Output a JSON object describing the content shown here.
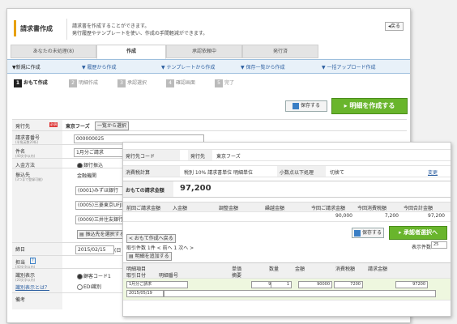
{
  "back": {
    "title": "請求書作成",
    "description": [
      "請求書を作成することができます。",
      "発行履歴やテンプレートを使い、作成の手間軽減ができます。"
    ],
    "back_button": "戻る",
    "tabs": [
      "あなたの未処理(8)",
      "作成",
      "承認依頼中",
      "発行済"
    ],
    "subnav": [
      "▼新規に作成",
      "▼ 履歴から作成",
      "▼ テンプレートから作成",
      "▼ 保存一覧から作成",
      "▼ 一括アップロード作成"
    ],
    "steps": [
      {
        "num": "1",
        "label": "おもて作成"
      },
      {
        "num": "2",
        "label": "明細作成"
      },
      {
        "num": "3",
        "label": "承認選択"
      },
      {
        "num": "4",
        "label": "確認画面"
      },
      {
        "num": "5",
        "label": "完了"
      }
    ],
    "save_button": "保存する",
    "create_detail_button": "明細を作成する",
    "form": {
      "issuer_label": "発行先",
      "required_badge": "必須",
      "issuer_value": "東京フーズ",
      "issuer_select": "一覧から選択",
      "invoice_no_label": "請求書番号",
      "invoice_no_sub": "(半角英数20桁)",
      "invoice_no_value": "000000025",
      "subject_label": "件名",
      "subject_sub": "(40文字以内)",
      "subject_value": "1月分ご請求",
      "payment_label": "入金方法",
      "payment_value": "銀行振込",
      "transfer_label": "振込先",
      "transfer_sub": "(3つまで登録可能)",
      "bank_header": "金融機関",
      "banks": [
        "(0001)みずほ銀行",
        "(0005)三菱東京UFJ銀行",
        "(0009)三井住友銀行"
      ],
      "bank_select": "振込先を選択する",
      "due_label": "締日",
      "due_value": "2015/02/15",
      "due_suffix": "(日",
      "person_label": "担当",
      "person_sub": "(40文字以内)",
      "code_label": "識別表示",
      "code_sub": "(20文字以内)",
      "code_link": "識別表示とは？",
      "code_option1": "顧客コード1",
      "code_option2": "EDI識別",
      "note_label": "備考"
    }
  },
  "front": {
    "issuer_code_label": "発行先コード",
    "issuer_label": "発行先",
    "issuer_value": "東京フーズ",
    "tax_calc_label": "消費税計算",
    "tax_calc_value": "税別 10% 請求書単位 明細単位",
    "tax_round_label": "小数点以下処理",
    "tax_round_value": "切捨て",
    "tax_link": "変更",
    "total_label": "おもての請求金額",
    "total_value": "97,200",
    "sum_headers": [
      "前回ご請求金額",
      "入金額",
      "調整金額",
      "繰越金額",
      "今回ご請求金額",
      "今回消費税額",
      "今回合計金額"
    ],
    "sum_values": [
      "",
      "",
      "",
      "",
      "90,000",
      "7,200",
      "97,200"
    ],
    "back_link": "< おもて作成へ戻る",
    "save_button": "保存する",
    "approver_button": "承認者選択へ",
    "display_count_label": "表示件数",
    "display_count_value": "25",
    "count_text": "取引件数 1件  < 前へ  1  次へ >",
    "add_detail_button": "明細を追加する",
    "table_headers_top": [
      "明細項目",
      "単価",
      "数量",
      "金額",
      "消費税額",
      "請求金額"
    ],
    "table_headers_bottom": [
      "取引日付",
      "明細番号",
      "摘要"
    ],
    "detail_item": "1月分ご請求",
    "detail_date": "2015/05/19",
    "detail_price": "90000",
    "detail_qty": "1",
    "detail_amount": "90000",
    "detail_tax": "7200",
    "detail_total": "97200"
  }
}
